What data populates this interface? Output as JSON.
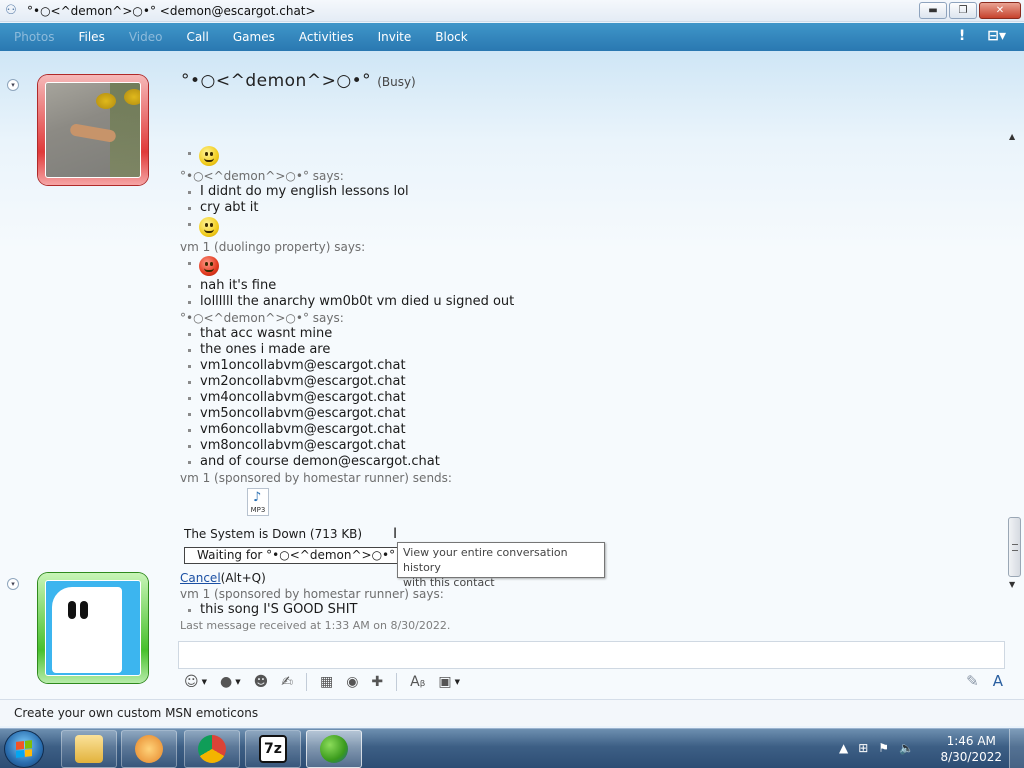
{
  "window": {
    "title": "°•○<^demon^>○•° <demon@escargot.chat>",
    "buttons": {
      "minimize": "▬",
      "maximize": "❐",
      "close": "✕"
    }
  },
  "menu": {
    "items": [
      {
        "label": "Photos",
        "enabled": false
      },
      {
        "label": "Files",
        "enabled": true
      },
      {
        "label": "Video",
        "enabled": false
      },
      {
        "label": "Call",
        "enabled": true
      },
      {
        "label": "Games",
        "enabled": true
      },
      {
        "label": "Activities",
        "enabled": true
      },
      {
        "label": "Invite",
        "enabled": true
      },
      {
        "label": "Block",
        "enabled": true
      }
    ],
    "alert_glyph": "!",
    "options_glyph": "⊟▾"
  },
  "contact": {
    "name": "°•○<^demon^>○•°",
    "status": "(Busy)"
  },
  "conversation": {
    "sender1_says": "°•○<^demon^>○•° says:",
    "msg_a1": "I didnt do my english lessons lol",
    "msg_a2": "cry abt it",
    "sender2_says": "vm 1 (duolingo property) says:",
    "msg_b1": "nah it's fine",
    "msg_b2": "lollllll the anarchy wm0b0t vm died u signed out",
    "sender3_says": "°•○<^demon^>○•° says:",
    "msg_c": [
      "that acc wasnt mine",
      "the ones i made are",
      "vm1oncollabvm@escargot.chat",
      "vm2oncollabvm@escargot.chat",
      "vm4oncollabvm@escargot.chat",
      "vm5oncollabvm@escargot.chat",
      "vm6oncollabvm@escargot.chat",
      "vm8oncollabvm@escargot.chat",
      "and of course demon@escargot.chat"
    ],
    "sender4_sends": "vm 1 (sponsored by homestar runner) sends:",
    "file": {
      "icon_label": "MP3",
      "name": "The System is Down (713 KB)",
      "waiting": "Waiting for °•○<^demon^>○•° to accept"
    },
    "cancel_label": "Cancel",
    "cancel_shortcut": "(Alt+Q)",
    "sender5_says": "vm 1 (sponsored by homestar runner) says:",
    "msg_e": "this song I'S GOOD SHIT",
    "last_message": "Last message received at 1:33 AM on 8/30/2022."
  },
  "tooltip": {
    "line1": "View your entire conversation history",
    "line2": "with this contact"
  },
  "bottom": {
    "promo": "Create your own custom MSN emoticons"
  },
  "taskbar": {
    "time": "1:46 AM",
    "date": "8/30/2022",
    "apps": [
      "windows-explorer",
      "media-player",
      "chrome",
      "7-zip",
      "windows-live-messenger"
    ]
  },
  "colors": {
    "menu_bar": "#2f82bb",
    "busy_frame": "#e03a3a",
    "online_frame": "#48c02d",
    "link": "#1a4fa3"
  }
}
